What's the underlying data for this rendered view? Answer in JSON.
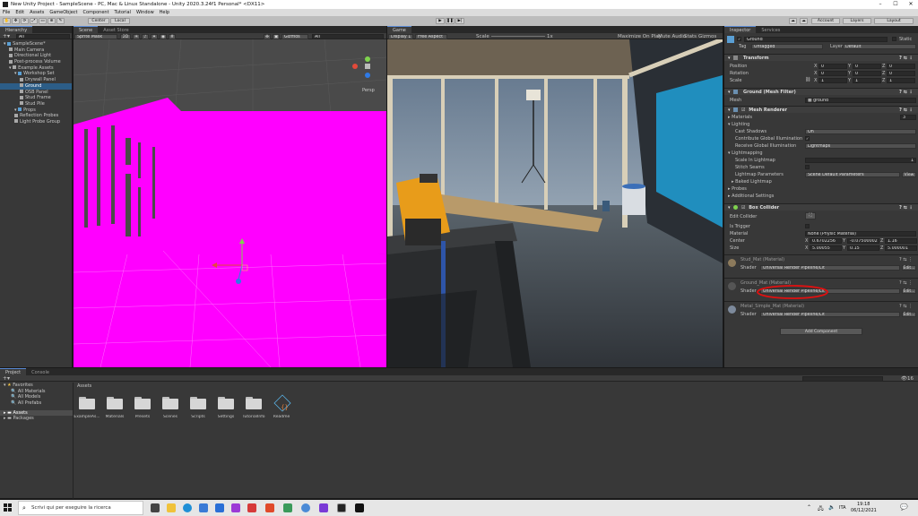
{
  "window": {
    "title": "New Unity Project - SampleScene - PC, Mac & Linux Standalone - Unity 2020.3.24f1 Personal* <DX11>"
  },
  "menu": [
    "File",
    "Edit",
    "Assets",
    "GameObject",
    "Component",
    "Tutorial",
    "Window",
    "Help"
  ],
  "toolbar": {
    "pivot": "Center",
    "space": "Local",
    "account": "Account",
    "layers": "Layers",
    "layout": "Layout"
  },
  "hierarchy": {
    "tab": "Hierarchy",
    "search_placeholder": "All",
    "items": [
      {
        "label": "SampleScene*",
        "indent": 0,
        "kind": "scene"
      },
      {
        "label": "Main Camera",
        "indent": 1,
        "kind": "object"
      },
      {
        "label": "Directional Light",
        "indent": 1,
        "kind": "object"
      },
      {
        "label": "Post-process Volume",
        "indent": 1,
        "kind": "object"
      },
      {
        "label": "Example Assets",
        "indent": 1,
        "kind": "object"
      },
      {
        "label": "Workshop Set",
        "indent": 2,
        "kind": "prefab"
      },
      {
        "label": "Drywall Panel",
        "indent": 3,
        "kind": "object"
      },
      {
        "label": "Ground",
        "indent": 3,
        "kind": "object",
        "selected": true
      },
      {
        "label": "OSB Panel",
        "indent": 3,
        "kind": "object"
      },
      {
        "label": "Stud Frame",
        "indent": 3,
        "kind": "object"
      },
      {
        "label": "Stud Pile",
        "indent": 3,
        "kind": "object"
      },
      {
        "label": "Props",
        "indent": 2,
        "kind": "prefab"
      },
      {
        "label": "Reflection Probes",
        "indent": 2,
        "kind": "object"
      },
      {
        "label": "Light Probe Group",
        "indent": 2,
        "kind": "object"
      }
    ]
  },
  "scene": {
    "tab": "Scene",
    "tab2": "Asset Store",
    "draw_mode": "Sprite Mask",
    "value": "2D",
    "gizmos": "Gizmos",
    "search": "All",
    "persp": "Persp",
    "magenta": "#ff00ff"
  },
  "game": {
    "tab": "Game",
    "display": "Display 1",
    "aspect": "Free Aspect",
    "scale_label": "Scale",
    "scale_value": "1x",
    "maximize": "Maximize On Play",
    "mute": "Mute Audio",
    "stats": "Stats",
    "gizmos": "Gizmos"
  },
  "inspector": {
    "tab": "Inspector",
    "tab2": "Services",
    "object_name": "Ground",
    "static_label": "Static",
    "tag_label": "Tag",
    "tag_value": "Untagged",
    "layer_label": "Layer",
    "layer_value": "Default",
    "transform": {
      "title": "Transform",
      "position_label": "Position",
      "rotation_label": "Rotation",
      "scale_label": "Scale",
      "position": [
        "0",
        "0",
        "0"
      ],
      "rotation": [
        "0",
        "0",
        "0"
      ],
      "scale": [
        "1",
        "1",
        "1"
      ]
    },
    "mesh_filter": {
      "title": "Ground (Mesh Filter)",
      "mesh_label": "Mesh",
      "mesh_value": "ground"
    },
    "mesh_renderer": {
      "title": "Mesh Renderer",
      "materials_label": "Materials",
      "materials_count": "3",
      "lighting_label": "Lighting",
      "cast_shadows_label": "Cast Shadows",
      "cast_shadows_value": "On",
      "contribute_gi_label": "Contribute Global Illumination",
      "receive_gi_label": "Receive Global Illumination",
      "receive_gi_value": "Lightmaps",
      "lightmapping_label": "Lightmapping",
      "scale_in_lightmap_label": "Scale In Lightmap",
      "scale_in_lightmap_value": "1",
      "stitch_seams_label": "Stitch Seams",
      "lightmap_params_label": "Lightmap Parameters",
      "lightmap_params_value": "Scene Default Parameters",
      "view_label": "View",
      "baked_lightmap_label": "Baked Lightmap",
      "probes_label": "Probes",
      "additional_settings_label": "Additional Settings"
    },
    "box_collider": {
      "title": "Box Collider",
      "edit_collider_label": "Edit Collider",
      "is_trigger_label": "Is Trigger",
      "material_label": "Material",
      "material_value": "None (Physic Material)",
      "center_label": "Center",
      "size_label": "Size",
      "center": [
        "0.6702256",
        "-0.07500002",
        "1.16"
      ],
      "size": [
        "5.00055",
        "0.15",
        "5.000001"
      ]
    },
    "materials": [
      {
        "name": "Stud_Mat (Material)",
        "shader_label": "Shader",
        "shader": "Universal Render Pipeline/Lit",
        "edit": "Edit...",
        "color": "#8c7a5c"
      },
      {
        "name": "Ground_Mat (Material)",
        "shader_label": "Shader",
        "shader": "Universal Render Pipeline/Lit",
        "edit": "Edit...",
        "color": "#555555"
      },
      {
        "name": "Metal_Simple_Mat (Material)",
        "shader_label": "Shader",
        "shader": "Universal Render Pipeline/Lit",
        "edit": "Edit...",
        "color": "#7d8a9c"
      }
    ],
    "add_component": "Add Component"
  },
  "project": {
    "tab": "Project",
    "tab2": "Console",
    "favorites_label": "Favorites",
    "favorites": [
      "All Materials",
      "All Models",
      "All Prefabs"
    ],
    "assets_label": "Assets",
    "packages_label": "Packages",
    "breadcrumb": "Assets",
    "count": "16",
    "folders": [
      "ExampleAs...",
      "Materials",
      "Presets",
      "Scenes",
      "Scripts",
      "Settings",
      "TutorialInfo",
      "Readme"
    ]
  },
  "taskbar": {
    "search_placeholder": "Scrivi qui per eseguire la ricerca",
    "lang": "ITA",
    "time": "19:18",
    "date": "06/12/2021"
  }
}
